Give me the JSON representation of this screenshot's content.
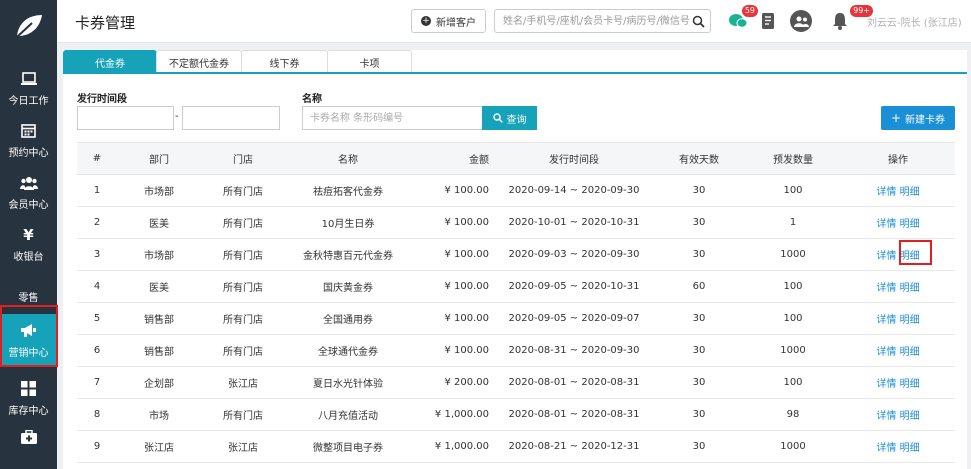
{
  "header": {
    "title": "卡券管理",
    "add_customer_label": "新增客户",
    "search_placeholder": "姓名/手机号/座机/会员卡号/病历号/微信号",
    "chat_badge": "59",
    "bell_badge": "99+",
    "user_name": "刘云云-院长 (张江店)"
  },
  "sidebar": {
    "items": [
      {
        "label": "今日工作",
        "icon": "laptop-icon"
      },
      {
        "label": "预约中心",
        "icon": "calendar-icon"
      },
      {
        "label": "会员中心",
        "icon": "users-icon"
      },
      {
        "label": "收银台",
        "icon": "yen-icon"
      },
      {
        "label": "零售",
        "icon": "retail-icon"
      },
      {
        "label": "营销中心",
        "icon": "megaphone-icon"
      },
      {
        "label": "库存中心",
        "icon": "grid-icon"
      },
      {
        "label": "",
        "icon": "medkit-icon"
      }
    ]
  },
  "tabs": [
    "代金券",
    "不定额代金券",
    "线下券",
    "卡项"
  ],
  "filters": {
    "period_label": "发行时间段",
    "date_separator": "-",
    "name_label": "名称",
    "name_placeholder": "卡券名称 条形码编号",
    "query_label": "查询",
    "new_card_label": "新建卡券"
  },
  "table": {
    "headers": [
      "#",
      "部门",
      "门店",
      "名称",
      "金额",
      "发行时间段",
      "有效天数",
      "预发数量",
      "操作"
    ],
    "action_labels": [
      "详情",
      "明细"
    ],
    "rows": [
      {
        "no": "1",
        "dept": "市场部",
        "store": "所有门店",
        "name": "祛痘拓客代金券",
        "amount": "¥ 100.00",
        "period": "2020-09-14 ~ 2020-09-30",
        "days": "30",
        "qty": "100"
      },
      {
        "no": "2",
        "dept": "医美",
        "store": "所有门店",
        "name": "10月生日券",
        "amount": "¥ 100.00",
        "period": "2020-10-01 ~ 2020-10-31",
        "days": "30",
        "qty": "1"
      },
      {
        "no": "3",
        "dept": "市场部",
        "store": "所有门店",
        "name": "金秋特惠百元代金券",
        "amount": "¥ 100.00",
        "period": "2020-09-03 ~ 2020-09-30",
        "days": "30",
        "qty": "1000"
      },
      {
        "no": "4",
        "dept": "医美",
        "store": "所有门店",
        "name": "国庆黄金券",
        "amount": "¥ 100.00",
        "period": "2020-09-05 ~ 2020-10-31",
        "days": "60",
        "qty": "100"
      },
      {
        "no": "5",
        "dept": "销售部",
        "store": "所有门店",
        "name": "全国通用券",
        "amount": "¥ 100.00",
        "period": "2020-09-05 ~ 2020-09-07",
        "days": "30",
        "qty": "100"
      },
      {
        "no": "6",
        "dept": "销售部",
        "store": "所有门店",
        "name": "全球通代金券",
        "amount": "¥ 100.00",
        "period": "2020-08-31 ~ 2020-09-30",
        "days": "30",
        "qty": "1000"
      },
      {
        "no": "7",
        "dept": "企划部",
        "store": "张江店",
        "name": "夏日水光针体验",
        "amount": "¥ 200.00",
        "period": "2020-08-01 ~ 2020-08-31",
        "days": "30",
        "qty": "100"
      },
      {
        "no": "8",
        "dept": "市场",
        "store": "所有门店",
        "name": "八月充值活动",
        "amount": "¥ 1,000.00",
        "period": "2020-08-01 ~ 2020-08-31",
        "days": "30",
        "qty": "98"
      },
      {
        "no": "9",
        "dept": "张江店",
        "store": "张江店",
        "name": "微整项目电子券",
        "amount": "¥ 1,000.00",
        "period": "2020-08-21 ~ 2020-12-31",
        "days": "30",
        "qty": "1000"
      }
    ]
  },
  "colors": {
    "sidebar_bg": "#27333f",
    "accent": "#16a2b8",
    "link": "#1a8fd6",
    "highlight_box": "#e02020"
  }
}
